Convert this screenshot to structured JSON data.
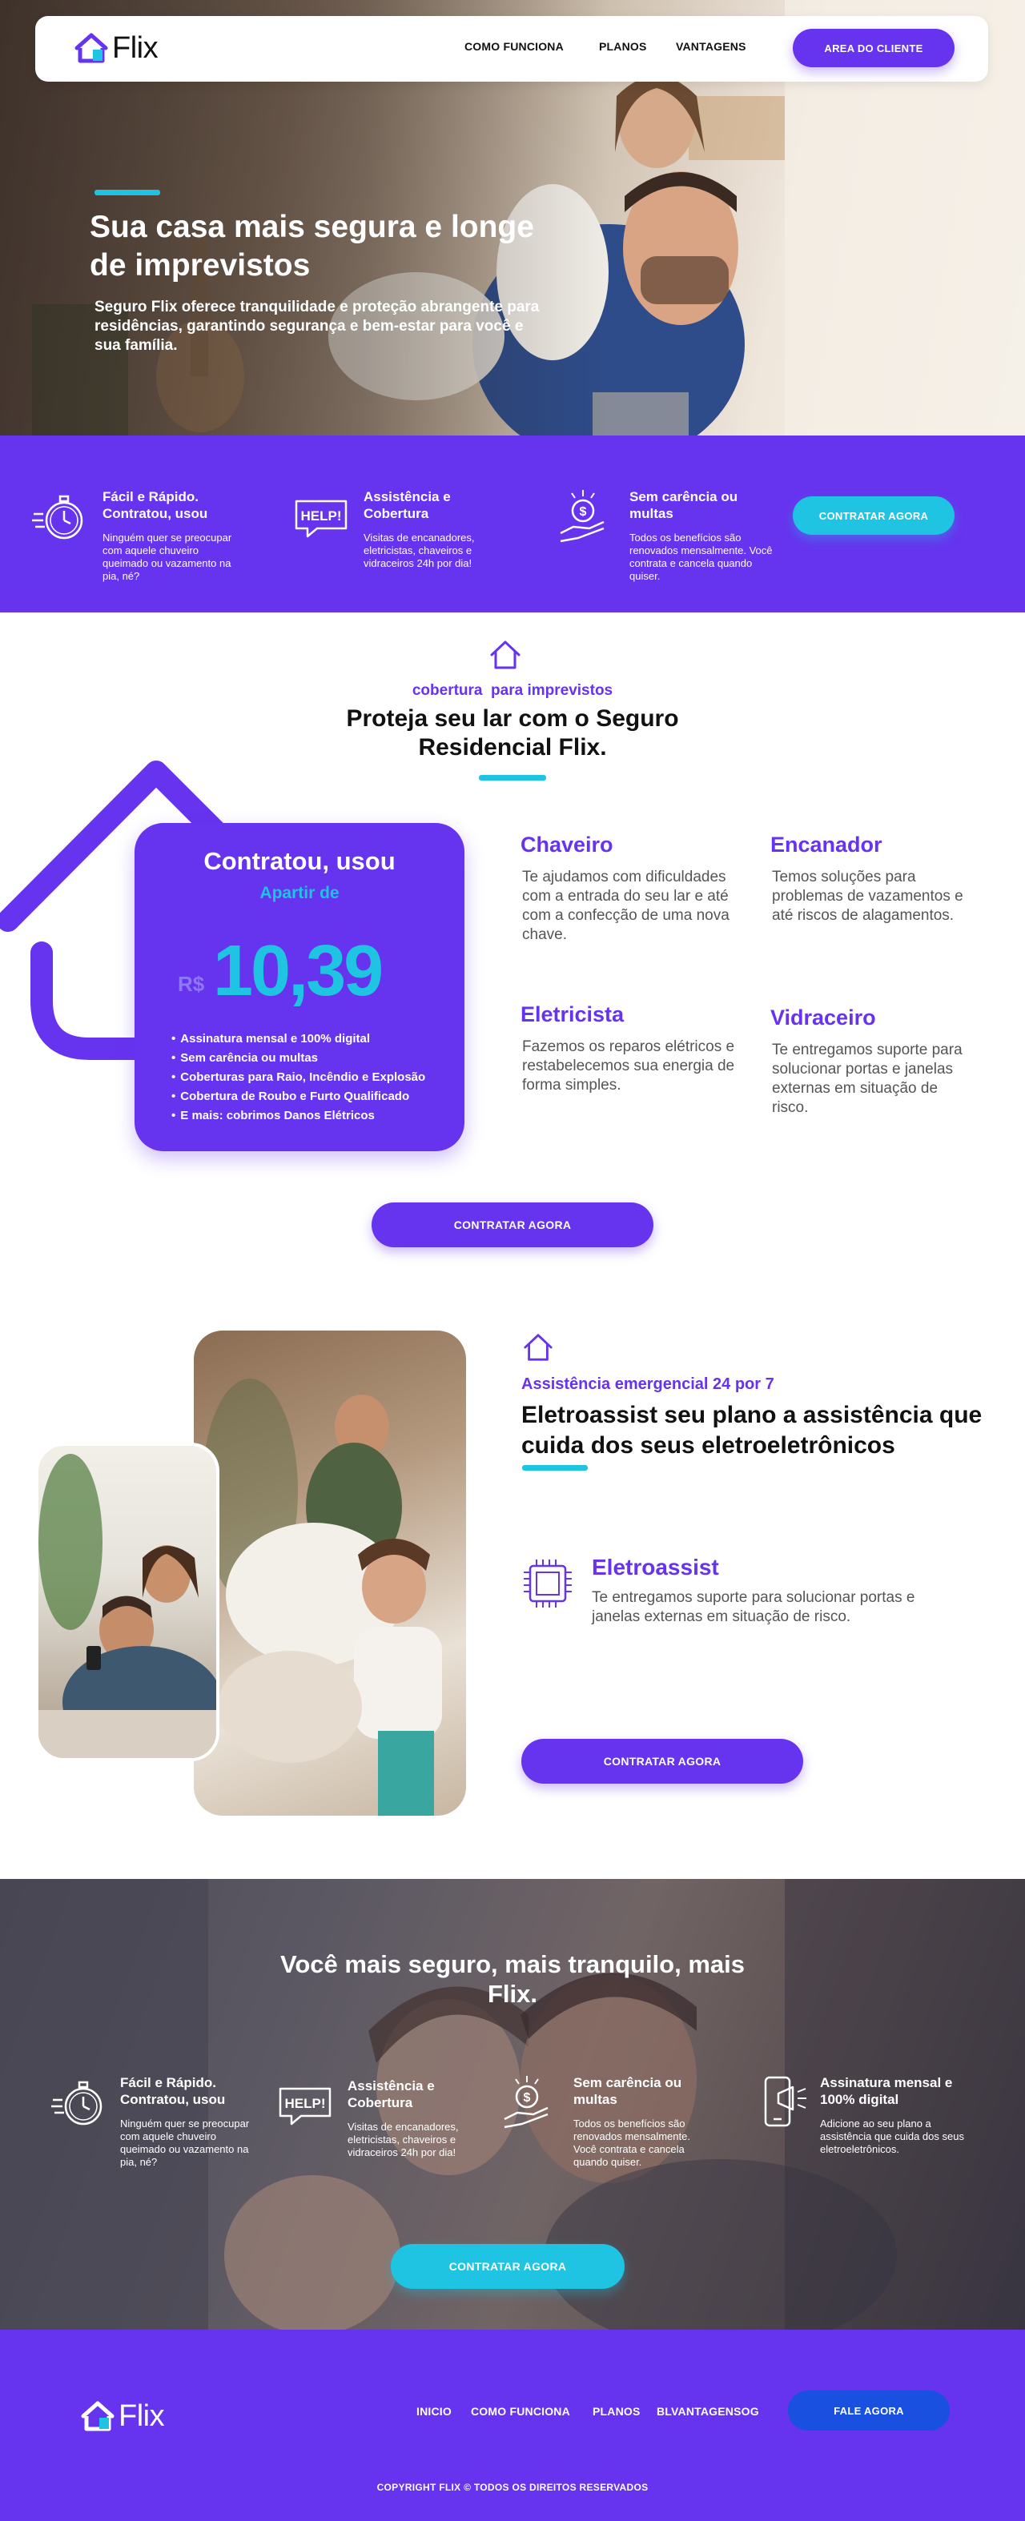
{
  "brand": {
    "name": "Flix"
  },
  "colors": {
    "primary": "#6633ee",
    "accent": "#1fc4e3",
    "footer_button": "#1a50e0"
  },
  "nav": {
    "links": [
      "COMO FUNCIONA",
      "PLANOS",
      "VANTAGENS"
    ],
    "cta": "AREA DO CLIENTE"
  },
  "hero": {
    "title": "Sua casa mais segura e longe de imprevistos",
    "text": "Seguro Flix oferece tranquilidade e proteção abrangente para residências, garantindo segurança e bem-estar para você e sua família."
  },
  "features": {
    "items": [
      {
        "icon": "stopwatch-icon",
        "title": "Fácil e Rápido. Contratou, usou",
        "text": "Ninguém quer se preocupar com aquele chuveiro queimado ou vazamento na pia, né?"
      },
      {
        "icon": "help-sign-icon",
        "title": "Assistência e Cobertura",
        "text": "Visitas de encanadores, eletricistas, chaveiros e vidraceiros 24h por dia!"
      },
      {
        "icon": "money-hand-icon",
        "title": "Sem carência ou multas",
        "text": "Todos os benefícios são renovados mensalmente. Você contrata e cancela quando quiser."
      }
    ],
    "cta": "CONTRATAR AGORA"
  },
  "coverage": {
    "eyebrow": "cobertura  para imprevistos",
    "title": "Proteja seu lar com o Seguro Residencial Flix.",
    "card": {
      "title": "Contratou, usou",
      "subtitle": "Apartir de",
      "currency": "R$",
      "price": "10,39",
      "bullets": [
        "Assinatura mensal e 100% digital",
        "Sem carência ou multas",
        "Coberturas para Raio, Incêndio e Explosão",
        "Cobertura de Roubo e Furto Qualificado",
        "E mais: cobrimos Danos Elétricos"
      ]
    },
    "services": [
      {
        "title": "Chaveiro",
        "text": "Te ajudamos com dificuldades com a entrada do seu lar e até com a confecção de uma nova chave."
      },
      {
        "title": "Encanador",
        "text": "Temos soluções para problemas de vazamentos e até riscos de alagamentos."
      },
      {
        "title": "Eletricista",
        "text": "Fazemos os reparos elétricos e restabelecemos sua energia de forma simples."
      },
      {
        "title": "Vidraceiro",
        "text": "Te entregamos suporte para solucionar portas e janelas externas em situação de risco."
      }
    ],
    "cta": "CONTRATAR AGORA"
  },
  "eletro": {
    "eyebrow": "Assistência emergencial 24 por 7",
    "title": "Eletroassist seu plano a assistência que cuida dos seus eletroeletrônicos",
    "item": {
      "title": "Eletroassist",
      "text": "Te entregamos suporte para solucionar portas e janelas externas em situação de risco."
    },
    "cta": "CONTRATAR AGORA"
  },
  "benefits": {
    "title": "Você mais seguro, mais tranquilo, mais Flix.",
    "items": [
      {
        "icon": "stopwatch-icon",
        "title": "Fácil e Rápido. Contratou, usou",
        "text": "Ninguém quer se preocupar com aquele chuveiro queimado ou vazamento na pia, né?"
      },
      {
        "icon": "help-sign-icon",
        "title": "Assistência e Cobertura",
        "text": "Visitas de encanadores, eletricistas, chaveiros e vidraceiros 24h por dia!"
      },
      {
        "icon": "money-hand-icon",
        "title": "Sem carência ou multas",
        "text": "Todos os benefícios são renovados mensalmente. Você contrata e cancela quando quiser."
      },
      {
        "icon": "phone-megaphone-icon",
        "title": "Assinatura mensal e 100% digital",
        "text": "Adicione ao seu plano a assistência que cuida dos seus eletroeletrônicos."
      }
    ],
    "cta": "CONTRATAR AGORA"
  },
  "footer": {
    "links": [
      "INICIO",
      "COMO FUNCIONA",
      "PLANOS",
      "BLVANTAGENSOG"
    ],
    "cta": "FALE AGORA",
    "copyright": "COPYRIGHT FLIX © TODOS OS DIREITOS RESERVADOS"
  }
}
